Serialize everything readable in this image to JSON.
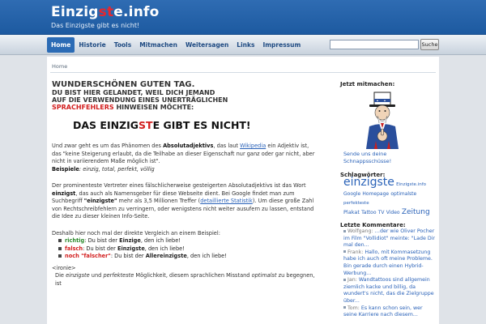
{
  "header": {
    "title_pre": "Einzig",
    "title_hl": "st",
    "title_post": "e.info",
    "tagline": "Das Einzigste gibt es nicht!"
  },
  "nav": {
    "items": [
      "Home",
      "Historie",
      "Tools",
      "Mitmachen",
      "Weitersagen",
      "Links",
      "Impressum"
    ],
    "search_button": "Suche",
    "search_value": ""
  },
  "breadcrumb": "Home",
  "main": {
    "h1": "WUNDERSCHÖNEN GUTEN TAG.",
    "h2_line1": "DU BIST HIER GELANDET, WEIL DICH JEMAND",
    "h2_line2": "AUF DIE VERWENDUNG EINES UNERTRÄGLICHEN",
    "h2_red": "SPRACHFEHLERS",
    "h2_end": " HINWEISEN MÖCHTE:",
    "big_pre": "DAS EINZIG",
    "big_red": "ST",
    "big_post": "E GIBT ES NICHT!",
    "p1_a": "Und zwar geht es um das Phänomen des ",
    "p1_b": "Absolutadjektivs",
    "p1_c": ", das laut ",
    "p1_link": "Wikipedia",
    "p1_d": " ein Adjektiv ist, das \"keine Steigerung erlaubt, da die Teilhabe an dieser Eigenschaft nur ganz oder gar nicht, aber nicht in variierendem Maße möglich ist\".",
    "p1_ex_label": "Beispiele",
    "p1_ex": ": einzig, total, perfekt, völlig",
    "p2_a": "Der prominenteste Vertreter eines fälschlicherweise gesteigerten Absolutadjektivs ist das Wort ",
    "p2_b": "einzigst",
    "p2_c": ", das auch als Namensgeber für diese Webseite dient. Bei Google findet man zum Suchbegriff ",
    "p2_d": "\"einzigste\"",
    "p2_e": " mehr als 3,5 Millionen Treffer (",
    "p2_link": "detaillierte Statistik",
    "p2_f": "). Um diese große Zahl von Rechtschreibfehlern zu verringern, oder wenigstens nicht weiter ausufern zu lassen, entstand die Idee zu dieser kleinen Info-Seite.",
    "p3": "Deshalb hier noch mal der direkte Vergleich an einem Beispiel:",
    "list": [
      {
        "label": "richtig",
        "a": ": Du bist der ",
        "b": "Einzige",
        "c": ", den ich liebe!"
      },
      {
        "label": "falsch",
        "a": ": Du bist der ",
        "b": "Einzigste",
        "c": ", den ich liebe!"
      },
      {
        "label": "noch \"falscher\"",
        "a": ": Du bist der ",
        "b": "Allereinzigste",
        "c": ", den ich liebe!"
      }
    ],
    "ironie": "<ironie>",
    "last_a": "Die ",
    "last_b": "einzigste",
    "last_c": " und ",
    "last_d": "perfekteste",
    "last_e": " Möglichkeit, diesem sprachlichen Misstand ",
    "last_f": "optimalst",
    "last_g": " zu begegnen, ist"
  },
  "sidebar": {
    "mitmachen_title": "Jetzt mitmachen:",
    "send_link": "Sende uns deine Schnappsschüsse!",
    "tags_title": "Schlagwörter:",
    "tags": [
      {
        "t": "einzigste",
        "s": 14
      },
      {
        "t": "Einzigste.info",
        "s": 5.5
      },
      {
        "t": "Google",
        "s": 6
      },
      {
        "t": "Homepage",
        "s": 6
      },
      {
        "t": "optimalste",
        "s": 6
      },
      {
        "t": "perfekteste",
        "s": 5.5
      },
      {
        "t": "Plakat",
        "s": 6.5
      },
      {
        "t": "Tattoo",
        "s": 6
      },
      {
        "t": "TV",
        "s": 6
      },
      {
        "t": "Video",
        "s": 6
      },
      {
        "t": "Zeitung",
        "s": 9
      }
    ],
    "comments_title": "Letzte Kommentare:",
    "comments": [
      {
        "author": "Wolfgang:",
        "text": " …der wie Oliver Pocher im Film \"Vollidiot\" meinte: \"Lade Dir mal den..."
      },
      {
        "author": "Frank:",
        "text": " Hallo, mit Kommasetzung habe ich auch oft meine Probleme. Bin gerade durch einen Hybrid-Werbung..."
      },
      {
        "author": "Jan:",
        "text": " Wandtattoos sind allgemein ziemlich kacke und billig, da wundert's nicht, das die Zielgruppe über..."
      },
      {
        "author": "Tom:",
        "text": " Es kann schon sein, wer seine Karriere nach diesem..."
      }
    ]
  }
}
